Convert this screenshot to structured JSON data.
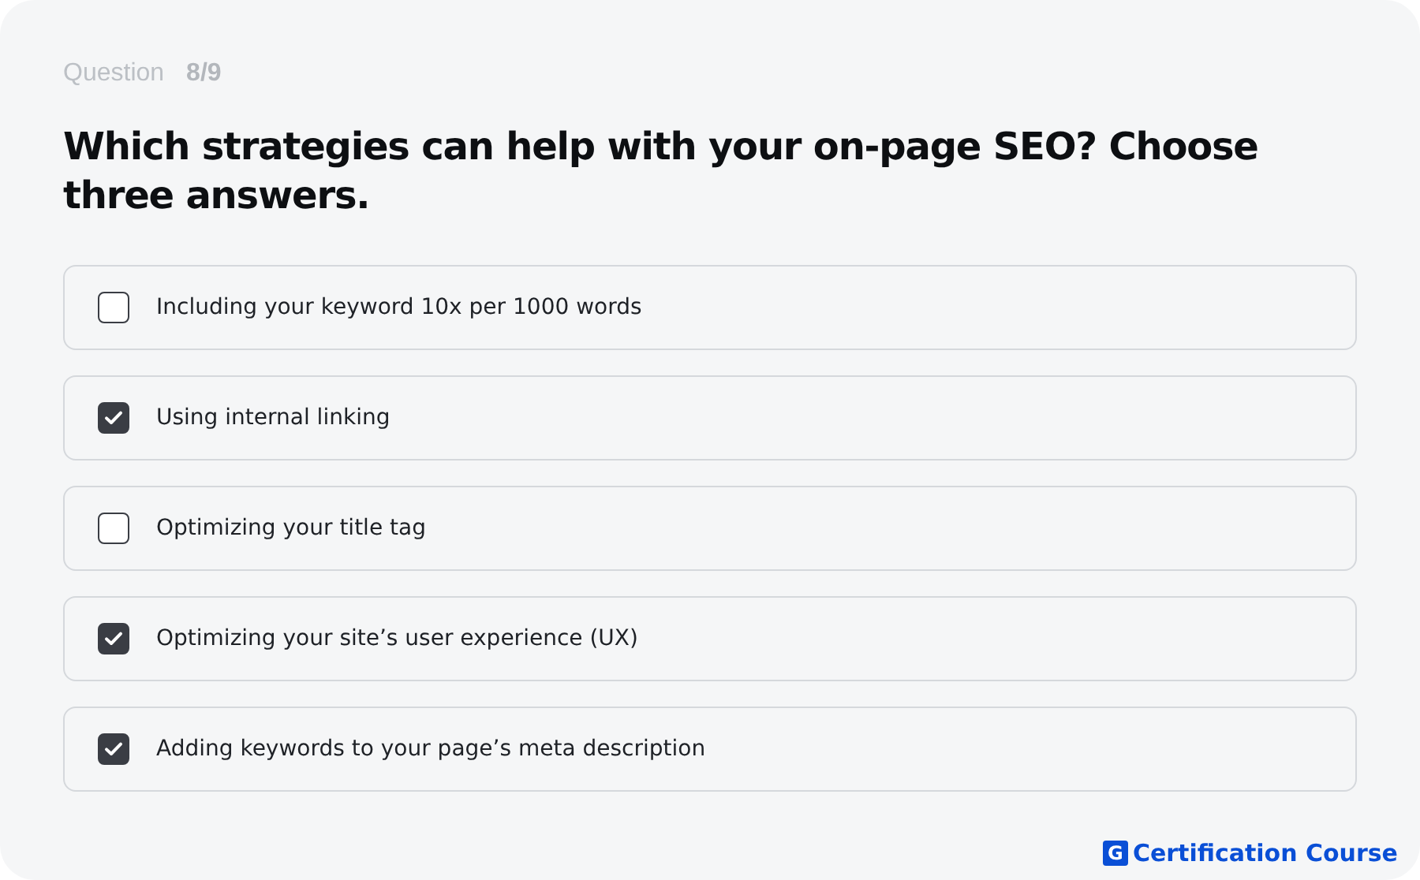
{
  "progress": {
    "label": "Question",
    "count": "8/9"
  },
  "question": "Which strategies can help with your on-page SEO? Choose three answers.",
  "options": [
    {
      "label": "Including your keyword 10x per 1000 words",
      "checked": false
    },
    {
      "label": "Using internal linking",
      "checked": true
    },
    {
      "label": "Optimizing your title tag",
      "checked": false
    },
    {
      "label": "Optimizing your site’s user experience (UX)",
      "checked": true
    },
    {
      "label": "Adding keywords to your page’s meta description",
      "checked": true
    }
  ],
  "brand": {
    "mark": "G",
    "name": "Certification Course"
  }
}
